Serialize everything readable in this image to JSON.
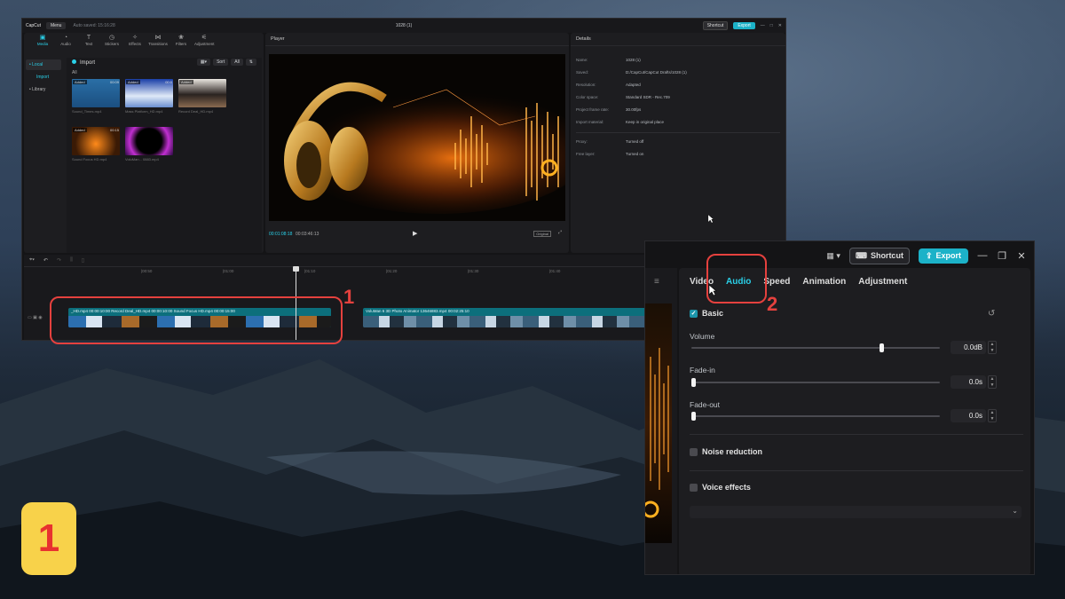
{
  "app": {
    "logo": "CapCut",
    "menu": "Menu",
    "autosave": "Auto saved: 15:16:28",
    "project_title": "1028 (1)",
    "shortcut": "Shortcut",
    "export": "Export"
  },
  "media_tabs": [
    {
      "label": "Media",
      "icon": "media-icon"
    },
    {
      "label": "Audio",
      "icon": "audio-icon"
    },
    {
      "label": "Text",
      "icon": "text-icon"
    },
    {
      "label": "Stickers",
      "icon": "stickers-icon"
    },
    {
      "label": "Effects",
      "icon": "effects-icon"
    },
    {
      "label": "Transitions",
      "icon": "transitions-icon"
    },
    {
      "label": "Filters",
      "icon": "filters-icon"
    },
    {
      "label": "Adjustment",
      "icon": "adjustment-icon"
    }
  ],
  "sidebar": {
    "local": "• Local",
    "import": "Import",
    "library": "• Library"
  },
  "media": {
    "import": "Import",
    "sort": "Sort",
    "all_filter": "All",
    "all_label": "All",
    "clips": [
      {
        "badge": "Added",
        "duration": "00:09",
        "name": "Sound_Times.mp4"
      },
      {
        "badge": "Added",
        "duration": "00:0",
        "name": "Mass Platform_HD.mp4"
      },
      {
        "badge": "Added",
        "duration": "",
        "name": "Record Deal_HD.mp4"
      },
      {
        "badge": "Added",
        "duration": "00:15",
        "name": "Sound Focus HD.mp4"
      },
      {
        "badge": "",
        "duration": "",
        "name": "VoluMan... 0883.mp4"
      }
    ]
  },
  "player": {
    "title": "Player",
    "current": "00:01:08:18",
    "total": "00:03:46:13",
    "original": "Original"
  },
  "details": {
    "title": "Details",
    "rows": [
      {
        "k": "Name:",
        "v": "1028 (1)"
      },
      {
        "k": "Saved:",
        "v": "D:/CapCut/CapCut Drafts/1028 (1)"
      },
      {
        "k": "Resolution:",
        "v": "Adapted"
      },
      {
        "k": "Color space:",
        "v": "Standard SDR - Rec.709"
      },
      {
        "k": "Project frame rate:",
        "v": "30.00fps"
      },
      {
        "k": "Import material:",
        "v": "Keep in original place"
      }
    ],
    "rows2": [
      {
        "k": "Proxy:",
        "v": "Turned off"
      },
      {
        "k": "Free layer:",
        "v": "Turned on"
      }
    ]
  },
  "timeline": {
    "ruler": [
      "|00:50",
      "|01:00",
      "|01:10",
      "|01:20",
      "|01:30",
      "|01:40"
    ],
    "track1": "_HD.mp4   00:00:10:00      Record Deal_HD.mp4   00:00:10:00      Sound Focus HD.mp4   00:00:15:00",
    "track2": "VoluMan 6 3D Photo Animator 13646883.mp4   00:02:25:10"
  },
  "annotations": {
    "one": "1",
    "two": "2",
    "badge": "1"
  },
  "audio_panel": {
    "shortcut": "Shortcut",
    "export": "Export",
    "tabs": [
      "Video",
      "Audio",
      "Speed",
      "Animation",
      "Adjustment"
    ],
    "active_tab": "Audio",
    "basic": "Basic",
    "volume_label": "Volume",
    "volume": "0.0dB",
    "volume_level": 0.77,
    "fadein_label": "Fade-in",
    "fadein": "0.0s",
    "fadeout_label": "Fade-out",
    "fadeout": "0.0s",
    "noise": "Noise reduction",
    "voice": "Voice effects"
  },
  "colors": {
    "accent": "#2ad0e8",
    "export": "#1cb2c8",
    "highlight": "#e5413e",
    "badge": "#f8d24a"
  }
}
